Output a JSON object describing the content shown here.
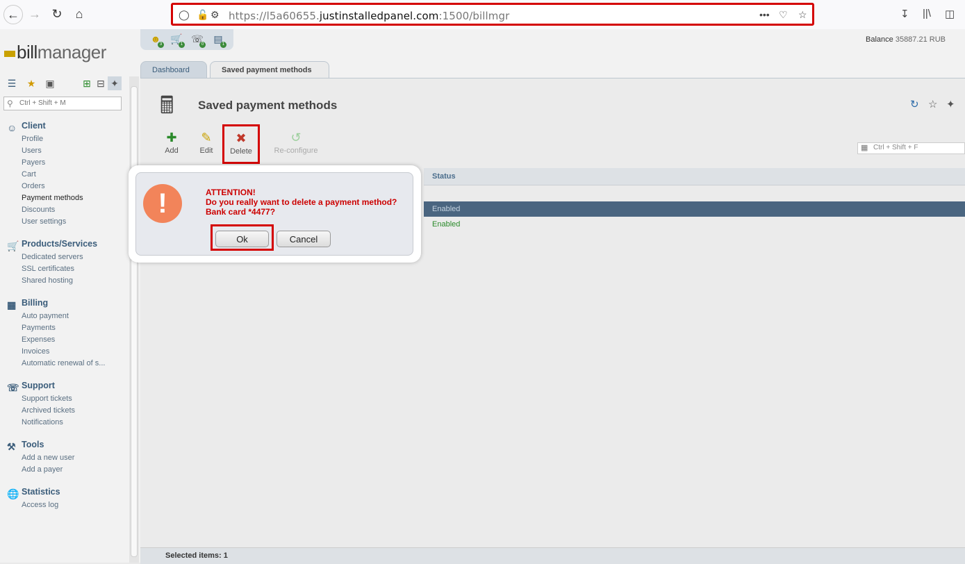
{
  "browser": {
    "url_prefix": "https://l5a60655.",
    "url_domain": "justinstalledpanel.com",
    "url_suffix": ":1500/billmgr",
    "icons": [
      "back-icon",
      "forward-icon",
      "reload-icon",
      "home-icon",
      "shield-icon",
      "lock-warning-icon",
      "permissions-icon",
      "more-icon",
      "pocket-icon",
      "bookmark-star-icon",
      "download-icon",
      "library-icon",
      "sidebar-icon"
    ]
  },
  "logo": {
    "part1": "bill",
    "part2": "manager"
  },
  "sidebar": {
    "search_placeholder": "Ctrl + Shift + M",
    "sections": [
      {
        "title": "Client",
        "icon": "person-icon",
        "items": [
          "Profile",
          "Users",
          "Payers",
          "Cart",
          "Orders",
          "Payment methods",
          "Discounts",
          "User settings"
        ]
      },
      {
        "title": "Products/Services",
        "icon": "cart-icon",
        "items": [
          "Dedicated servers",
          "SSL certificates",
          "Shared hosting"
        ]
      },
      {
        "title": "Billing",
        "icon": "cash-register-icon",
        "items": [
          "Auto payment",
          "Payments",
          "Expenses",
          "Invoices",
          "Automatic renewal of s..."
        ]
      },
      {
        "title": "Support",
        "icon": "headset-icon",
        "items": [
          "Support tickets",
          "Archived tickets",
          "Notifications"
        ]
      },
      {
        "title": "Tools",
        "icon": "tools-icon",
        "items": [
          "Add a new user",
          "Add a payer"
        ]
      },
      {
        "title": "Statistics",
        "icon": "globe-icon",
        "items": [
          "Access log"
        ]
      }
    ],
    "active_item": "Payment methods"
  },
  "header": {
    "badges": [
      "3",
      "1",
      "0",
      "1"
    ],
    "balance_label": "Balance",
    "balance_value": "35887.21 RUB"
  },
  "tabs": [
    {
      "label": "Dashboard"
    },
    {
      "label": "Saved payment methods"
    }
  ],
  "page": {
    "title": "Saved payment methods",
    "toolbar": {
      "add": "Add",
      "edit": "Edit",
      "delete": "Delete",
      "reconfigure": "Re-configure"
    },
    "filter_placeholder": "Ctrl + Shift + F",
    "column_status": "Status",
    "rows": [
      {
        "status": "Enabled",
        "selected": true
      },
      {
        "status": "Enabled",
        "selected": false
      }
    ],
    "status_bar": "Selected items: 1"
  },
  "dialog": {
    "line1": "ATTENTION!",
    "line2": "Do you really want to delete a payment method?",
    "line3": "Bank card *4477?",
    "ok": "Ok",
    "cancel": "Cancel"
  }
}
